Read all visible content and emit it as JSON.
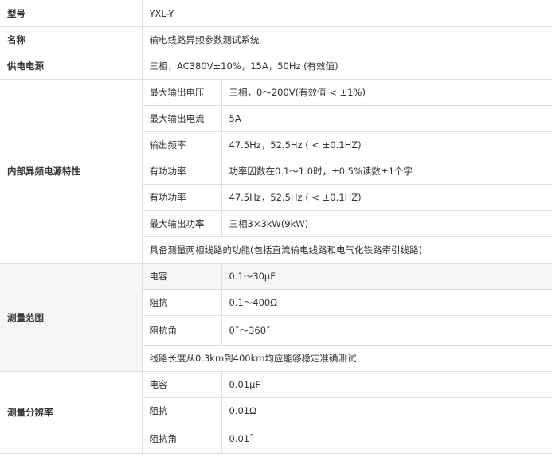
{
  "rows": {
    "model": {
      "label": "型号",
      "value": "YXL-Y"
    },
    "name": {
      "label": "名称",
      "value": "输电线路异频参数测试系统"
    },
    "power": {
      "label": "供电电源",
      "value": "三相，AC380V±10%，15A，50Hz (有效值)"
    }
  },
  "internal": {
    "label": "内部异频电源特性",
    "items": [
      {
        "name": "最大输出电压",
        "value": "三相，0～200V(有效值 < ±1%)"
      },
      {
        "name": "最大输出电流",
        "value": "5A"
      },
      {
        "name": "输出频率",
        "value": "47.5Hz，52.5Hz ( < ±0.1HZ)"
      },
      {
        "name": "有功功率",
        "value": "功率因数在0.1～1.0时，±0.5%读数±1个字"
      },
      {
        "name": "有功功率",
        "value": "47.5Hz，52.5Hz ( < ±0.1HZ)"
      },
      {
        "name": "最大输出功率",
        "value": "三相3×3kW(9kW)"
      }
    ],
    "note": "具备测量两相线路的功能(包括直流输电线路和电气化铁路牵引线路)"
  },
  "range": {
    "label": "测量范围",
    "items": [
      {
        "name": "电容",
        "value": "0.1～30μF"
      },
      {
        "name": "阻抗",
        "value": "0.1～400Ω"
      },
      {
        "name": "阻抗角",
        "value": "0˚～360˚"
      }
    ],
    "note": "线路长度从0.3km到400km均应能够稳定准确测试"
  },
  "resolution": {
    "label": "测量分辨率",
    "items": [
      {
        "name": "电容",
        "value": "0.01μF"
      },
      {
        "name": "阻抗",
        "value": "0.01Ω"
      },
      {
        "name": "阻抗角",
        "value": "0.01˚"
      }
    ]
  }
}
